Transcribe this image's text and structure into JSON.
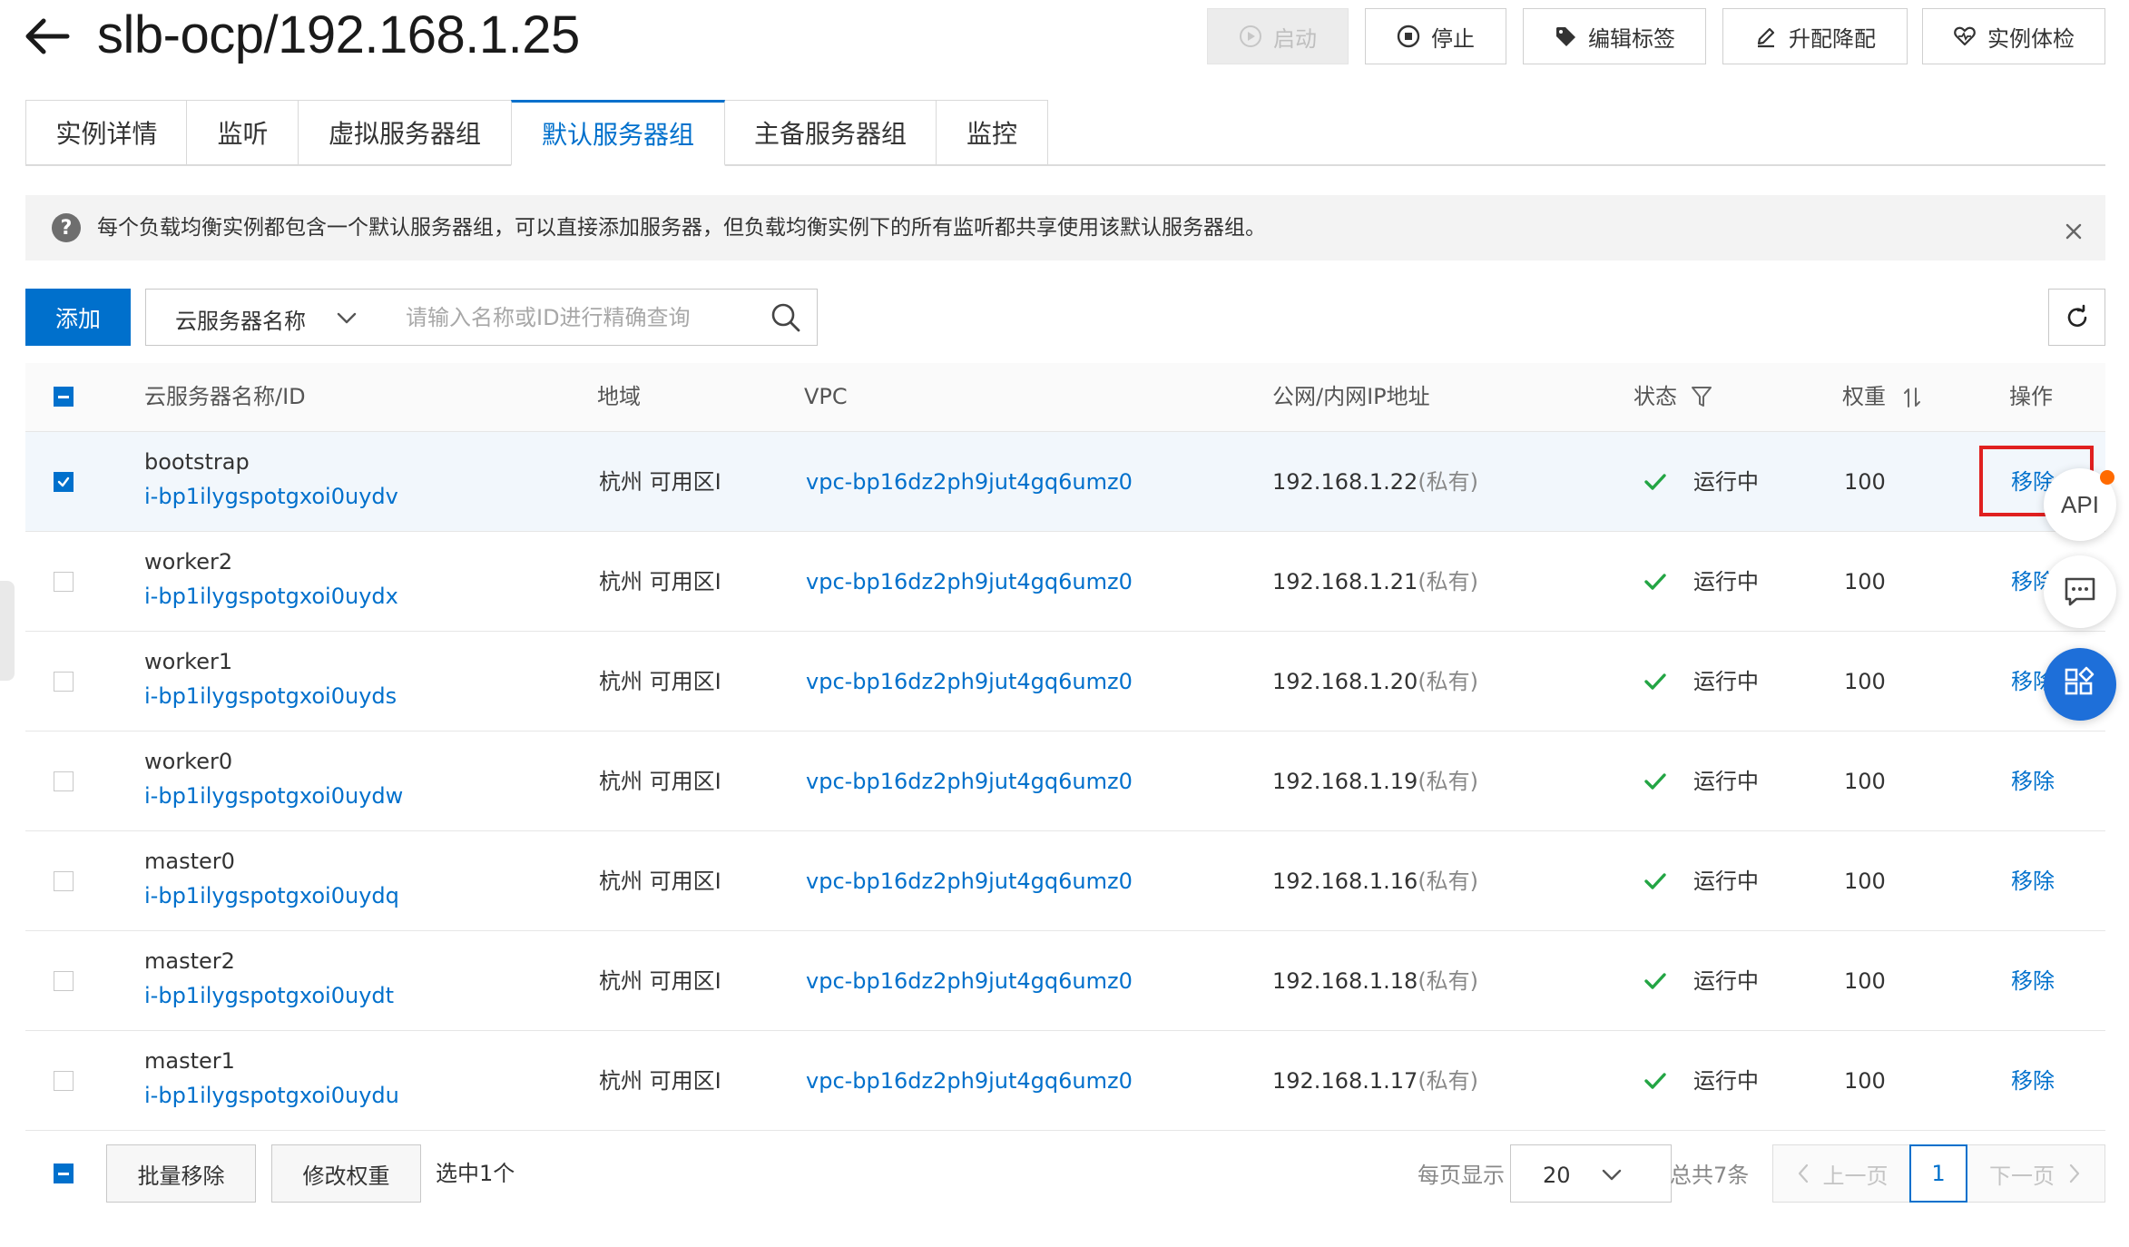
{
  "header": {
    "title": "slb-ocp/192.168.1.25",
    "buttons": {
      "start": "启动",
      "stop": "停止",
      "edit_tags": "编辑标签",
      "upgrade": "升配降配",
      "health_check": "实例体检"
    }
  },
  "tabs": [
    "实例详情",
    "监听",
    "虚拟服务器组",
    "默认服务器组",
    "主备服务器组",
    "监控"
  ],
  "active_tab": "默认服务器组",
  "notice": {
    "text": "每个负载均衡实例都包含一个默认服务器组，可以直接添加服务器，但负载均衡实例下的所有监听都共享使用该默认服务器组。"
  },
  "toolbar": {
    "add_label": "添加",
    "filter_selected": "云服务器名称",
    "search_placeholder": "请输入名称或ID进行精确查询"
  },
  "table": {
    "columns": {
      "name_id": "云服务器名称/ID",
      "region": "地域",
      "vpc": "VPC",
      "ip": "公网/内网IP地址",
      "status": "状态",
      "weight": "权重",
      "action": "操作"
    },
    "rows": [
      {
        "name": "bootstrap",
        "id": "i-bp1ilygspotgxoi0uydv",
        "region": "杭州 可用区I",
        "vpc": "vpc-bp16dz2ph9jut4gq6umz0",
        "ip": "192.168.1.22",
        "ip_type": "(私有)",
        "status": "运行中",
        "weight": "100",
        "action": "移除",
        "checked": true
      },
      {
        "name": "worker2",
        "id": "i-bp1ilygspotgxoi0uydx",
        "region": "杭州 可用区I",
        "vpc": "vpc-bp16dz2ph9jut4gq6umz0",
        "ip": "192.168.1.21",
        "ip_type": "(私有)",
        "status": "运行中",
        "weight": "100",
        "action": "移除",
        "checked": false
      },
      {
        "name": "worker1",
        "id": "i-bp1ilygspotgxoi0uyds",
        "region": "杭州 可用区I",
        "vpc": "vpc-bp16dz2ph9jut4gq6umz0",
        "ip": "192.168.1.20",
        "ip_type": "(私有)",
        "status": "运行中",
        "weight": "100",
        "action": "移除",
        "checked": false
      },
      {
        "name": "worker0",
        "id": "i-bp1ilygspotgxoi0uydw",
        "region": "杭州 可用区I",
        "vpc": "vpc-bp16dz2ph9jut4gq6umz0",
        "ip": "192.168.1.19",
        "ip_type": "(私有)",
        "status": "运行中",
        "weight": "100",
        "action": "移除",
        "checked": false
      },
      {
        "name": "master0",
        "id": "i-bp1ilygspotgxoi0uydq",
        "region": "杭州 可用区I",
        "vpc": "vpc-bp16dz2ph9jut4gq6umz0",
        "ip": "192.168.1.16",
        "ip_type": "(私有)",
        "status": "运行中",
        "weight": "100",
        "action": "移除",
        "checked": false
      },
      {
        "name": "master2",
        "id": "i-bp1ilygspotgxoi0uydt",
        "region": "杭州 可用区I",
        "vpc": "vpc-bp16dz2ph9jut4gq6umz0",
        "ip": "192.168.1.18",
        "ip_type": "(私有)",
        "status": "运行中",
        "weight": "100",
        "action": "移除",
        "checked": false
      },
      {
        "name": "master1",
        "id": "i-bp1ilygspotgxoi0uydu",
        "region": "杭州 可用区I",
        "vpc": "vpc-bp16dz2ph9jut4gq6umz0",
        "ip": "192.168.1.17",
        "ip_type": "(私有)",
        "status": "运行中",
        "weight": "100",
        "action": "移除",
        "checked": false
      }
    ]
  },
  "floating": {
    "api_label": "API"
  },
  "footer": {
    "batch_remove": "批量移除",
    "modify_weight": "修改权重",
    "selected_count": "选中1个",
    "per_page_label": "每页显示",
    "per_page_value": "20",
    "total": "总共7条",
    "prev": "上一页",
    "current_page": "1",
    "next": "下一页"
  },
  "colors": {
    "accent": "#0070cc",
    "success": "#23a544",
    "highlight_box": "#e02020",
    "fab_blue": "#1e6fd9",
    "notify_dot": "#ff6a00"
  }
}
